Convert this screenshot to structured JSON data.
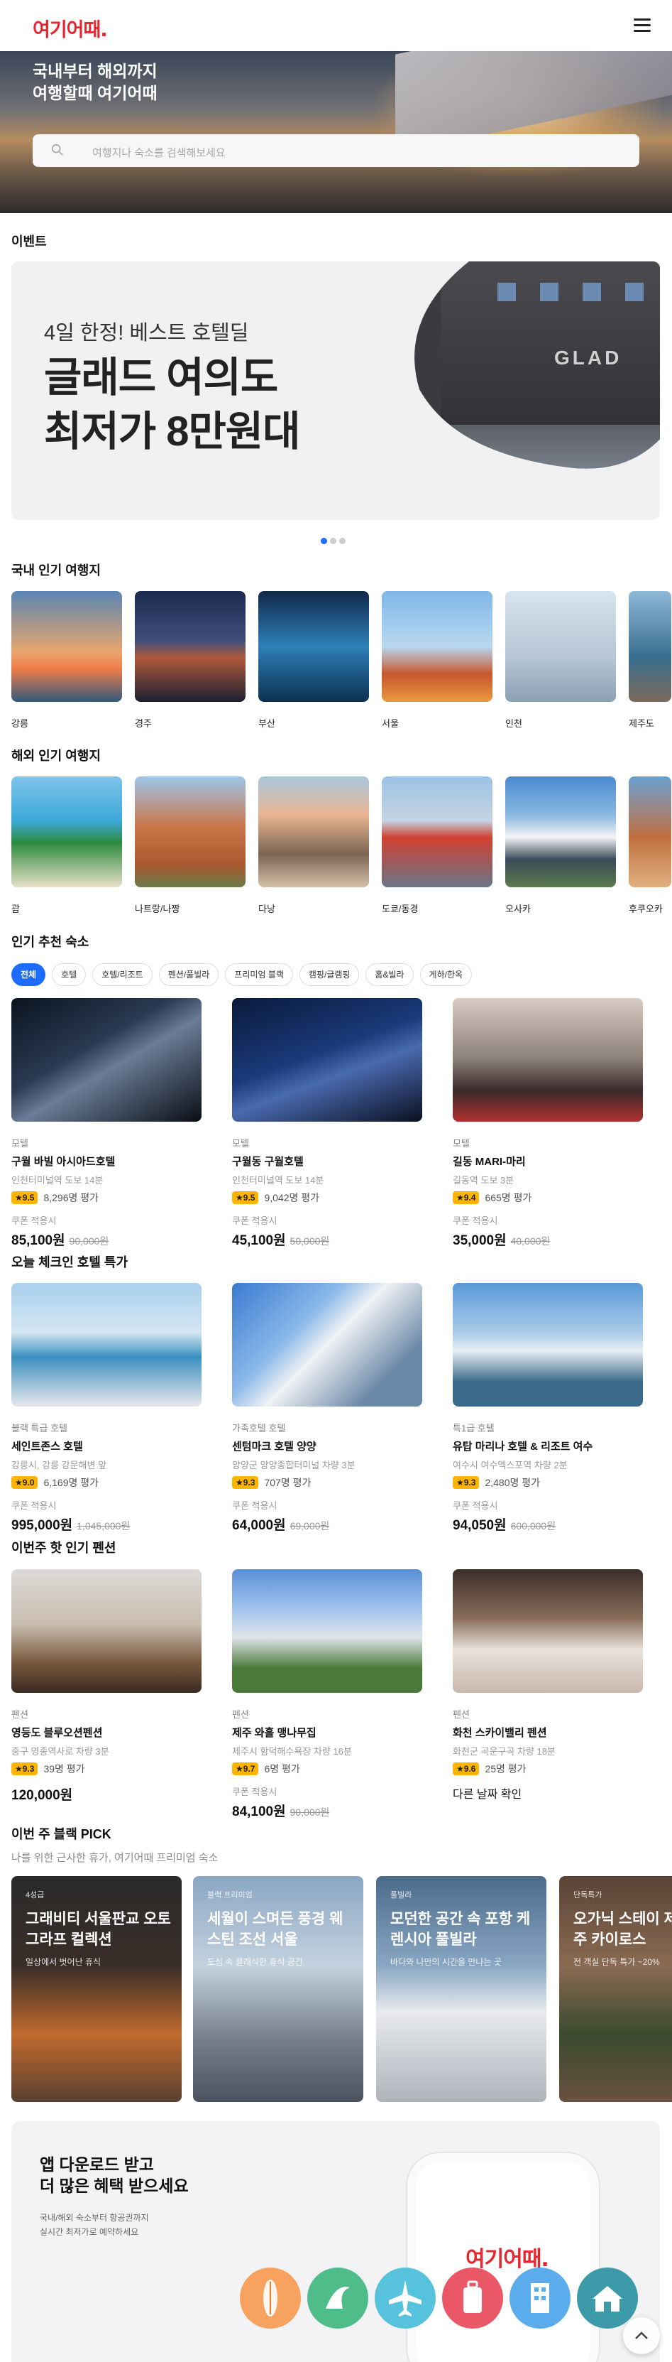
{
  "header": {
    "logo": "여기어때.",
    "menu_icon": "hamburger-menu-icon"
  },
  "hero": {
    "title_line1": "국내부터 해외까지",
    "title_line2": "여행할때 여기어때",
    "search_placeholder": "여행지나 숙소를 검색해보세요"
  },
  "event": {
    "section_title": "이벤트",
    "small": "4일 한정! 베스트 호텔딜",
    "big_line1": "글래드 여의도",
    "big_line2": "최저가 8만원대",
    "sign": "GLAD",
    "page_dots": 3,
    "active_dot": 1
  },
  "domestic": {
    "title": "국내 인기 여행지",
    "items": [
      "강릉",
      "경주",
      "부산",
      "서울",
      "인천",
      "제주도"
    ]
  },
  "overseas": {
    "title": "해외 인기 여행지",
    "items": [
      "괌",
      "나트랑/나짱",
      "다낭",
      "도쿄/동경",
      "오사카",
      "후쿠오카"
    ]
  },
  "recommend": {
    "title": "인기 추천 숙소",
    "chips": [
      "전체",
      "호텔",
      "호텔/리조트",
      "펜션/풀빌라",
      "프리미엄 블랙",
      "캠핑/글램핑",
      "홈&빌라",
      "게하/한옥"
    ],
    "cards": [
      {
        "cat": "모텔",
        "name": "구월 바빌 아시아드호텔",
        "loc": "인천터미널역 도보 14분",
        "rating": "9.5",
        "reviews": "8,296명 평가",
        "coupon": "쿠폰 적용시",
        "price": "85,100원",
        "orig": "90,000원"
      },
      {
        "cat": "모텔",
        "name": "구월동 구월호텔",
        "loc": "인천터미널역 도보 14분",
        "rating": "9.5",
        "reviews": "9,042명 평가",
        "coupon": "쿠폰 적용시",
        "price": "45,100원",
        "orig": "50,000원"
      },
      {
        "cat": "모텔",
        "name": "길동 MARI-마리",
        "loc": "길동역 도보 3분",
        "rating": "9.4",
        "reviews": "665명 평가",
        "coupon": "쿠폰 적용시",
        "price": "35,000원",
        "orig": "40,000원"
      }
    ]
  },
  "checkin": {
    "title": "오늘 체크인 호텔 특가",
    "cards": [
      {
        "cat": "블랙 특급 호텔",
        "name": "세인트존스 호텔",
        "loc": "강릉시, 강릉 강문해변 앞",
        "rating": "9.0",
        "reviews": "6,169명 평가",
        "coupon": "쿠폰 적용시",
        "price": "995,000원",
        "orig": "1,045,000원"
      },
      {
        "cat": "가족호텔 호텔",
        "name": "센텀마크 호텔 양양",
        "loc": "양양군 양양종합터미널 차량 3분",
        "rating": "9.3",
        "reviews": "707명 평가",
        "coupon": "쿠폰 적용시",
        "price": "64,000원",
        "orig": "69,000원"
      },
      {
        "cat": "특1급 호텔",
        "name": "유탑 마리나 호텔 & 리조트 여수",
        "loc": "여수시 여수엑스포역 차량 2분",
        "rating": "9.3",
        "reviews": "2,480명 평가",
        "coupon": "쿠폰 적용시",
        "price": "94,050원",
        "orig": "600,000원"
      }
    ]
  },
  "pension": {
    "title": "이번주 핫 인기 펜션",
    "cards": [
      {
        "cat": "펜션",
        "name": "영등도 블루오션펜션",
        "loc": "중구 영종역사로 차량 3분",
        "rating": "9.3",
        "reviews": "39명 평가",
        "coupon": "",
        "price": "120,000원",
        "orig": ""
      },
      {
        "cat": "펜션",
        "name": "제주 와흘 맹나무집",
        "loc": "제주시 함덕해수욕장 차량 16분",
        "rating": "9.7",
        "reviews": "6명 평가",
        "coupon": "쿠폰 적용시",
        "price": "84,100원",
        "orig": "90,000원"
      },
      {
        "cat": "펜션",
        "name": "화천 스카이밸리 펜션",
        "loc": "화천군 곡운구곡 차량 18분",
        "rating": "9.6",
        "reviews": "25명 평가",
        "coupon": "",
        "price": "다른 날짜 확인",
        "orig": ""
      }
    ]
  },
  "black": {
    "title": "이번 주 블랙 PICK",
    "subtitle": "나를 위한 근사한 휴가, 여기어때 프리미엄 숙소",
    "picks": [
      {
        "tag": "4성급",
        "title": "그래비티 서울판교 오토그라프 컬렉션",
        "desc": "일상에서 벗어난 휴식"
      },
      {
        "tag": "블랙 프리미엄",
        "title": "세월이 스며든 풍경 웨스틴 조선 서울",
        "desc": "도심 속 클래식한 휴식 공간"
      },
      {
        "tag": "풀빌라",
        "title": "모던한 공간 속 포항 케렌시아 풀빌라",
        "desc": "바다와 나만의 시간을 만나는 곳"
      },
      {
        "tag": "단독특가",
        "title": "오가닉 스테이 제주 카이로스",
        "desc": "전 객실 단독 특가 ~20%"
      }
    ]
  },
  "app": {
    "title_line1": "앱 다운로드 받고",
    "title_line2": "더 많은 혜택 받으세요",
    "desc_line1": "국내/해외 숙소부터 항공권까지",
    "desc_line2": "실시간 최저가로 예약하세요",
    "logo": "여기어때.",
    "icons": [
      "surfboard-icon",
      "surf-wave-icon",
      "airplane-icon",
      "suitcase-icon",
      "building-icon",
      "house-icon"
    ]
  },
  "colors": {
    "brand": "#e8242f",
    "accent": "#1e6cff",
    "rating": "#ffb400"
  }
}
